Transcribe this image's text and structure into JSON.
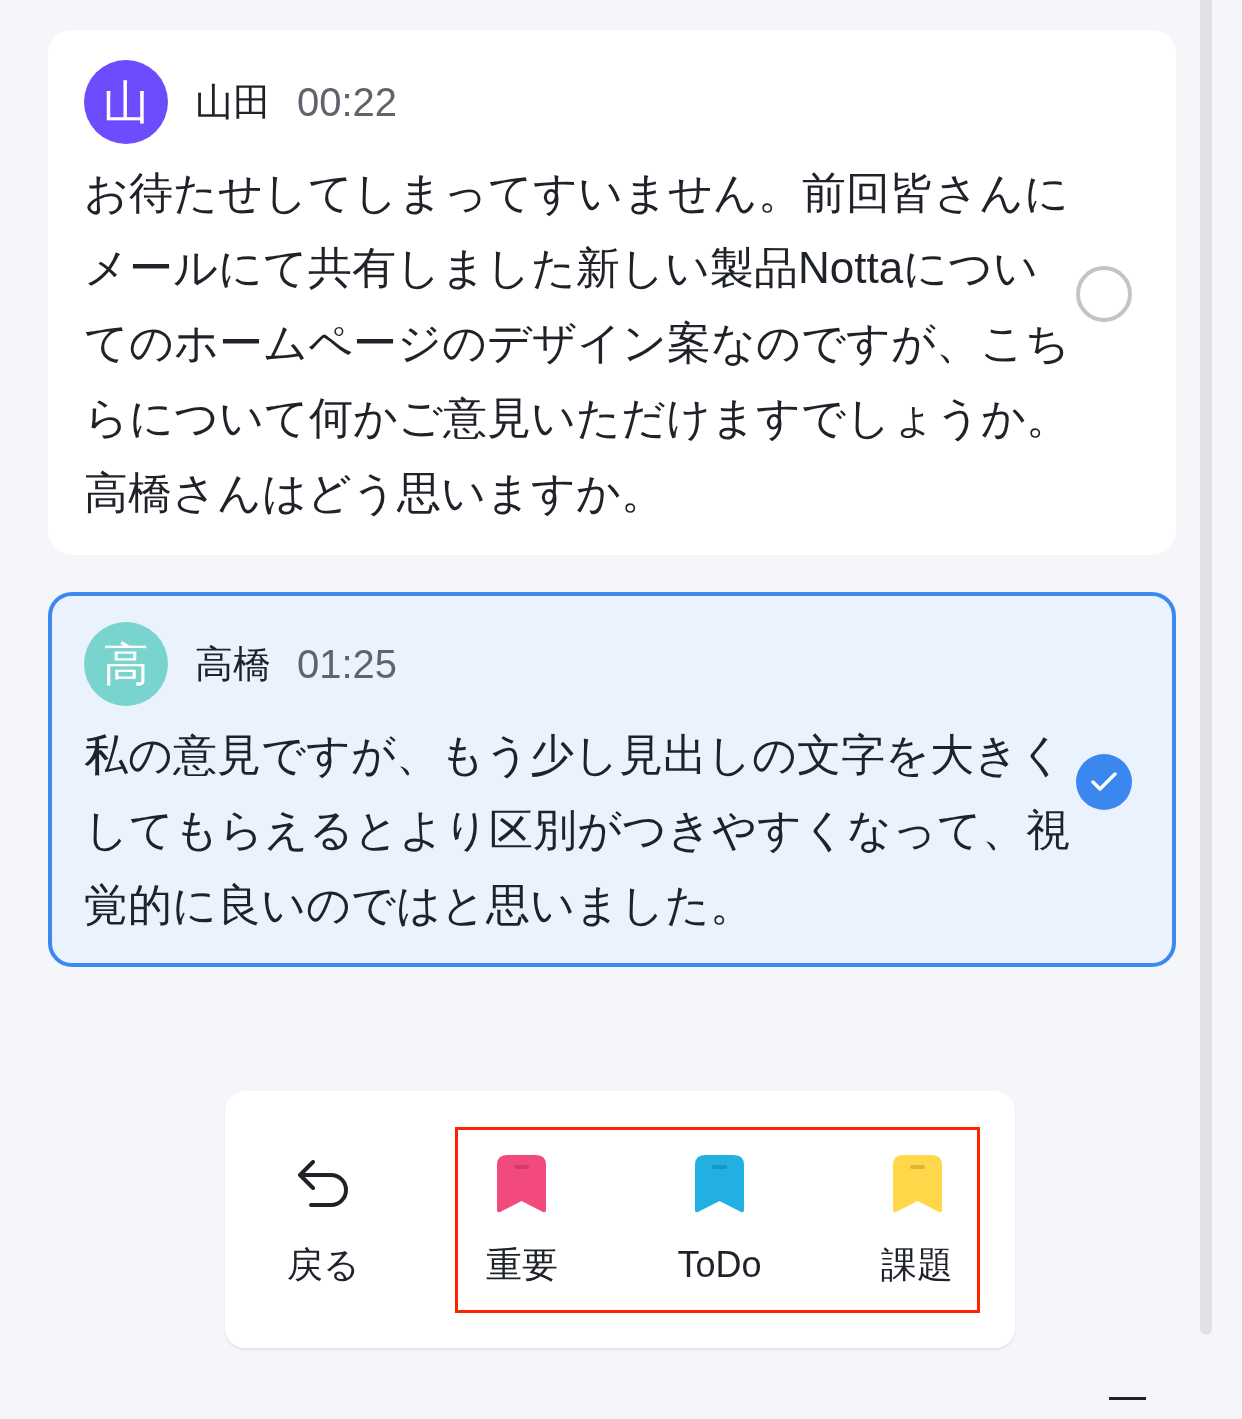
{
  "messages": [
    {
      "avatar": "山",
      "color": "#6c4cfd",
      "speaker": "山田",
      "time": "00:22",
      "text": "お待たせしてしまってすいません。前回皆さんにメールにて共有しました新しい製品Nottaについてのホームページのデザイン案なのですが、こちらについて何かご意見いただけますでしょうか。高橋さんはどう思いますか。",
      "selected": false
    },
    {
      "avatar": "高",
      "color": "#78d4cc",
      "speaker": "高橋",
      "time": "01:25",
      "text": "私の意見ですが、もう少し見出しの文字を大きくしてもらえるとより区別がつきやすくなって、視覚的に良いのではと思いました。",
      "selected": true
    }
  ],
  "toolbar": {
    "back": {
      "label": "戻る"
    },
    "tag_group": {
      "highlighted": true,
      "items": [
        {
          "label": "重要",
          "color": "#f34a7d"
        },
        {
          "label": "ToDo",
          "color": "#22afe1"
        },
        {
          "label": "課題",
          "color": "#ffd84a"
        }
      ]
    }
  }
}
